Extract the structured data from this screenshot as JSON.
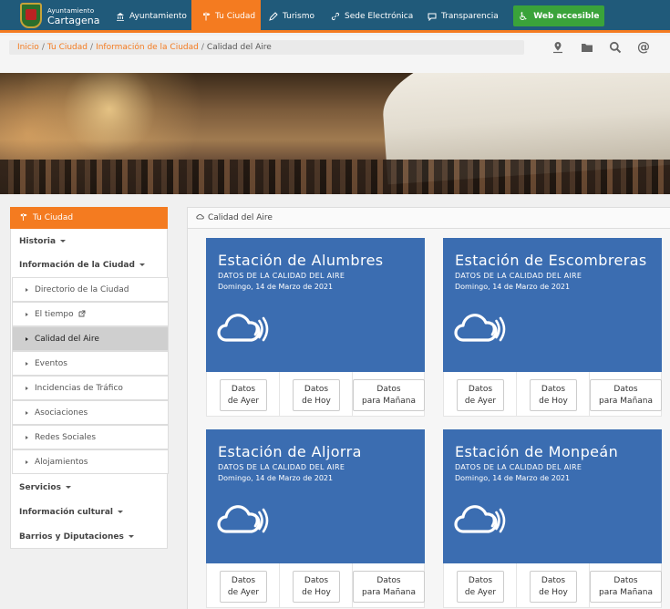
{
  "header": {
    "logo_line1": "Ayuntamiento",
    "logo_line2": "Cartagena",
    "nav": [
      {
        "label": "Ayuntamiento",
        "icon": "bank-icon"
      },
      {
        "label": "Tu Ciudad",
        "icon": "signpost-icon",
        "active": true
      },
      {
        "label": "Turismo",
        "icon": "pencil-icon"
      },
      {
        "label": "Sede Electrónica",
        "icon": "link-icon"
      },
      {
        "label": "Transparencia",
        "icon": "chat-icon"
      }
    ],
    "accessible_label": "Web accesible",
    "accent_color": "#f47b20",
    "nav_color": "#205a7a"
  },
  "breadcrumb": {
    "items": [
      "Inicio",
      "Tu Ciudad",
      "Información de la Ciudad"
    ],
    "current": "Calidad del Aire"
  },
  "tools": [
    "map-pin-icon",
    "folder-icon",
    "search-icon",
    "at-icon"
  ],
  "sidebar": {
    "header": "Tu Ciudad",
    "items": [
      {
        "label": "Historia"
      },
      {
        "label": "Información de la Ciudad"
      },
      {
        "label": "Servicios"
      },
      {
        "label": "Información cultural"
      },
      {
        "label": "Barrios y Diputaciones"
      }
    ],
    "subitems": [
      {
        "label": "Directorio de la Ciudad"
      },
      {
        "label": "El tiempo",
        "external": true
      },
      {
        "label": "Calidad del Aire",
        "active": true
      },
      {
        "label": "Eventos"
      },
      {
        "label": "Incidencias de Tráfico"
      },
      {
        "label": "Asociaciones"
      },
      {
        "label": "Redes Sociales"
      },
      {
        "label": "Alojamientos"
      }
    ]
  },
  "content": {
    "header": "Calidad del Aire",
    "card_color": "#3b6db1",
    "stations": [
      {
        "name": "Estación de Alumbres",
        "subtitle": "DATOS DE LA CALIDAD DEL AIRE",
        "date": "Domingo, 14 de Marzo de 2021"
      },
      {
        "name": "Estación de Escombreras",
        "subtitle": "DATOS DE LA CALIDAD DEL AIRE",
        "date": "Domingo, 14 de Marzo de 2021"
      },
      {
        "name": "Estación de Aljorra",
        "subtitle": "DATOS DE LA CALIDAD DEL AIRE",
        "date": "Domingo, 14 de Marzo de 2021"
      },
      {
        "name": "Estación de Monpeán",
        "subtitle": "DATOS DE LA CALIDAD DEL AIRE",
        "date": "Domingo, 14 de Marzo de 2021"
      }
    ],
    "buttons": [
      {
        "line1": "Datos",
        "line2": "de Ayer"
      },
      {
        "line1": "Datos",
        "line2": "de Hoy"
      },
      {
        "line1": "Datos",
        "line2": "para Mañana"
      }
    ]
  }
}
